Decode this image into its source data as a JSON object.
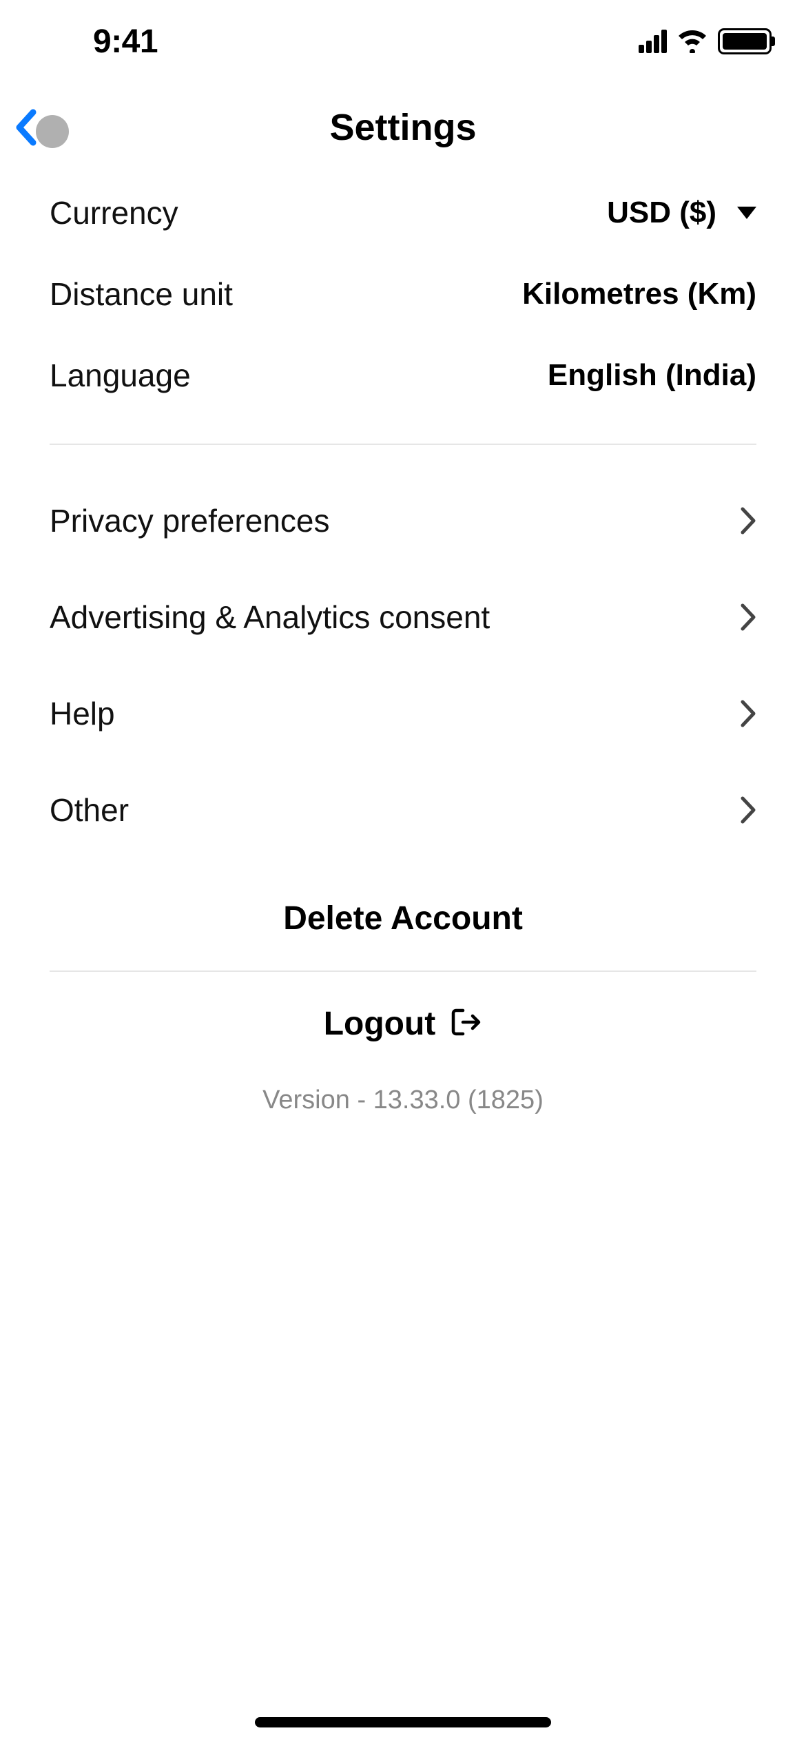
{
  "statusBar": {
    "time": "9:41"
  },
  "nav": {
    "title": "Settings"
  },
  "settings": {
    "currency": {
      "label": "Currency",
      "value": "USD ($)"
    },
    "distance": {
      "label": "Distance unit",
      "value": "Kilometres (Km)"
    },
    "language": {
      "label": "Language",
      "value": "English (India)"
    }
  },
  "links": {
    "privacy": "Privacy preferences",
    "advertising": "Advertising & Analytics consent",
    "help": "Help",
    "other": "Other"
  },
  "actions": {
    "delete": "Delete Account",
    "logout": "Logout"
  },
  "version": "Version - 13.33.0 (1825)"
}
